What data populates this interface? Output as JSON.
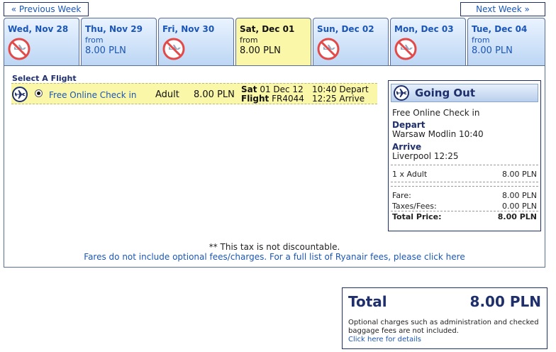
{
  "nav": {
    "prev_week": "« Previous Week",
    "next_week": "Next Week »"
  },
  "days": [
    {
      "label": "Wed, Nov 28",
      "available": false
    },
    {
      "label": "Thu, Nov 29",
      "from": "from",
      "price": "8.00 PLN",
      "available": true
    },
    {
      "label": "Fri, Nov 30",
      "available": false
    },
    {
      "label": "Sat, Dec 01",
      "from": "from",
      "price": "8.00 PLN",
      "available": true,
      "selected": true
    },
    {
      "label": "Sun, Dec 02",
      "available": false
    },
    {
      "label": "Mon, Dec 03",
      "available": false
    },
    {
      "label": "Tue, Dec 04",
      "from": "from",
      "price": "8.00 PLN",
      "available": true
    }
  ],
  "select": {
    "title": "Select A Flight",
    "flight": {
      "fare_name": "Free Online Check in",
      "passenger_type": "Adult",
      "price": "8.00 PLN",
      "day": "Sat",
      "date": "01 Dec 12",
      "flight_label": "Flight",
      "flight_no": "FR4044",
      "depart_time": "10:40",
      "depart_word": "Depart",
      "arrive_time": "12:25",
      "arrive_word": "Arrive"
    }
  },
  "summary": {
    "title": "Going Out",
    "fare_name": "Free Online Check in",
    "depart_label": "Depart",
    "depart_value": "Warsaw Modlin 10:40",
    "arrive_label": "Arrive",
    "arrive_value": "Liverpool 12:25",
    "passengers_label": "1 x Adult",
    "passengers_value": "8.00 PLN",
    "fare_label": "Fare:",
    "fare_value": "8.00 PLN",
    "taxes_label": "Taxes/Fees:",
    "taxes_value": "0.00 PLN",
    "total_label": "Total Price:",
    "total_value": "8.00 PLN"
  },
  "notes": {
    "tax": "** This tax is not discountable.",
    "fees_link": "Fares do not include optional fees/charges. For a full list of Ryanair fees, please click here"
  },
  "total": {
    "label": "Total",
    "value": "8.00 PLN",
    "note": "Optional charges such as administration and checked baggage fees are not included.",
    "link": "Click here for details"
  },
  "colors": {
    "accent": "#1a56b8",
    "navy": "#1f2f6b",
    "selected_bg": "#fbf7a8",
    "no_flight": "#e24a4a"
  }
}
